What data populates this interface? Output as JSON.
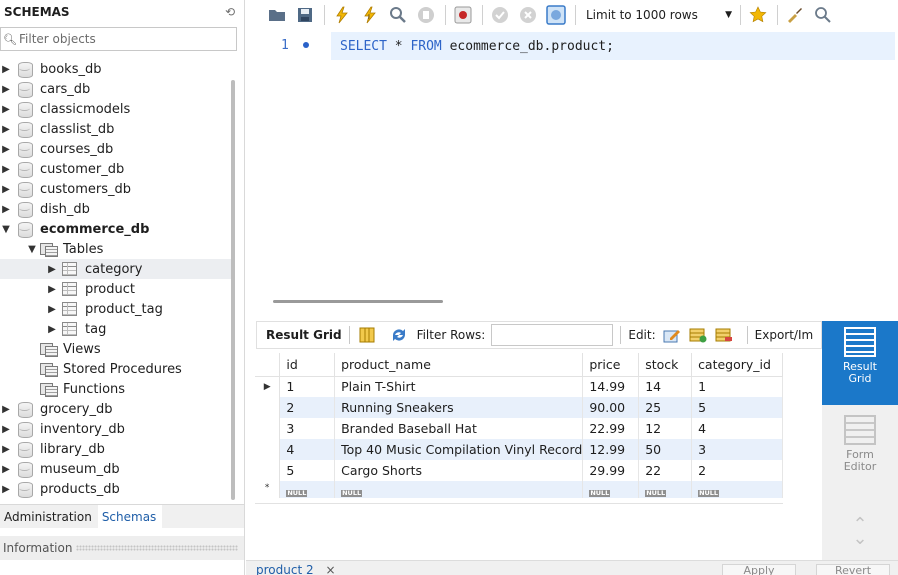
{
  "sidebar": {
    "title": "SCHEMAS",
    "filter_placeholder": "Filter objects",
    "schemas": [
      "books_db",
      "cars_db",
      "classicmodels",
      "classlist_db",
      "courses_db",
      "customer_db",
      "customers_db",
      "dish_db"
    ],
    "open_schema": "ecommerce_db",
    "tables_folder": "Tables",
    "tables": [
      "category",
      "product",
      "product_tag",
      "tag"
    ],
    "other_folders": [
      "Views",
      "Stored Procedures",
      "Functions"
    ],
    "schemas_after": [
      "grocery_db",
      "inventory_db",
      "library_db",
      "museum_db",
      "products_db"
    ],
    "tabs": [
      "Administration",
      "Schemas"
    ],
    "info_label": "Information"
  },
  "toolbar": {
    "limit_label": "Limit to 1000 rows"
  },
  "editor": {
    "line_number": "1",
    "query": {
      "select_kw": "SELECT",
      "star": " * ",
      "from_kw": "FROM",
      "target": " ecommerce_db.product;"
    }
  },
  "result": {
    "grid_label": "Result Grid",
    "filter_label": "Filter Rows:",
    "edit_label": "Edit:",
    "export_label": "Export/Im",
    "columns": [
      "id",
      "product_name",
      "price",
      "stock",
      "category_id"
    ],
    "rows": [
      [
        "1",
        "Plain T-Shirt",
        "14.99",
        "14",
        "1"
      ],
      [
        "2",
        "Running Sneakers",
        "90.00",
        "25",
        "5"
      ],
      [
        "3",
        "Branded Baseball Hat",
        "22.99",
        "12",
        "4"
      ],
      [
        "4",
        "Top 40 Music Compilation Vinyl Record",
        "12.99",
        "50",
        "3"
      ],
      [
        "5",
        "Cargo Shorts",
        "29.99",
        "22",
        "2"
      ]
    ],
    "null_label": "NULL",
    "new_row_marker": "*",
    "current_row_marker": "▶"
  },
  "side_panel": {
    "result_grid": [
      "Result",
      "Grid"
    ],
    "form_editor": [
      "Form",
      "Editor"
    ]
  },
  "bottom": {
    "tab_label": "product 2",
    "tab_close": "×",
    "apply": "Apply",
    "revert": "Revert"
  },
  "colors": {
    "accent": "#1b78c9",
    "keyword": "#2d64c8",
    "row_alt": "#e8f0fb"
  }
}
